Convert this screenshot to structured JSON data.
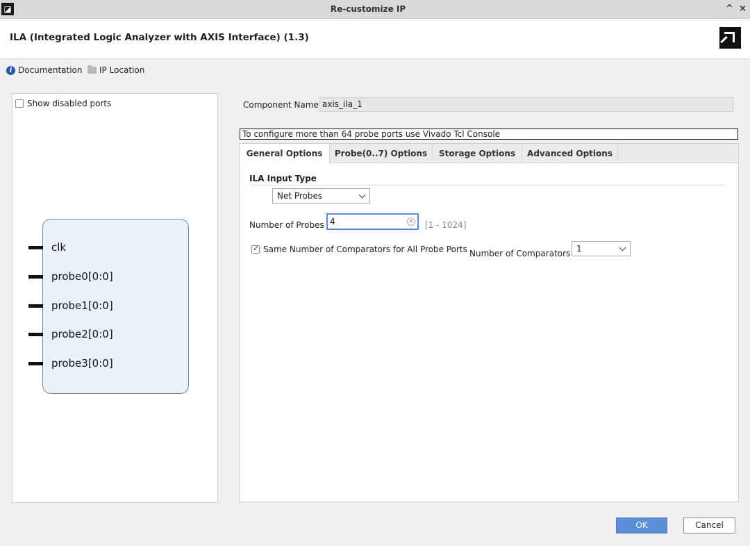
{
  "window": {
    "title": "Re-customize IP",
    "collapse_glyph": "^",
    "close_glyph": "×"
  },
  "header": {
    "ip_title": "ILA (Integrated Logic Analyzer with AXIS Interface) (1.3)"
  },
  "links": {
    "documentation": "Documentation",
    "ip_location": "IP Location"
  },
  "left_panel": {
    "show_disabled_label": "Show disabled ports",
    "show_disabled_checked": false,
    "ports": [
      "clk",
      "probe0[0:0]",
      "probe1[0:0]",
      "probe2[0:0]",
      "probe3[0:0]"
    ]
  },
  "component": {
    "label": "Component Name",
    "value": "axis_ila_1"
  },
  "notice": "To configure more than 64 probe ports use Vivado Tcl Console",
  "tabs": [
    {
      "label": "General Options",
      "active": true
    },
    {
      "label": "Probe(0..7) Options",
      "active": false
    },
    {
      "label": "Storage Options",
      "active": false
    },
    {
      "label": "Advanced Options",
      "active": false
    }
  ],
  "general": {
    "section_title": "ILA Input Type",
    "input_type": "Net Probes",
    "num_probes_label": "Number of Probes",
    "num_probes_value": "4",
    "num_probes_range": "[1 - 1024]",
    "same_comparators_label": "Same Number of Comparators for All Probe Ports",
    "same_comparators_checked": true,
    "num_comparators_label": "Number of Comparators",
    "num_comparators_value": "1"
  },
  "buttons": {
    "ok": "OK",
    "cancel": "Cancel"
  },
  "colors": {
    "accent": "#5b8ed6",
    "block_fill": "#eaf1fb",
    "block_border": "#6f89ab"
  }
}
